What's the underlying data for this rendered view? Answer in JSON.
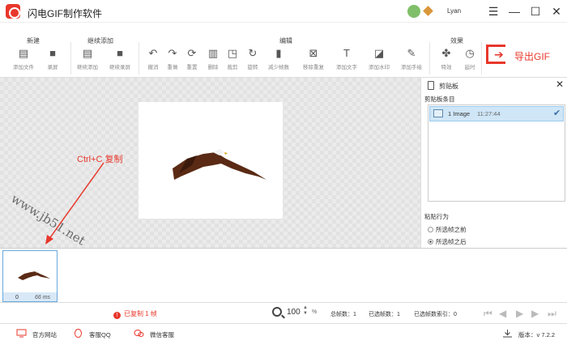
{
  "app": {
    "title": "闪电GIF制作软件",
    "username": "Lyan"
  },
  "window": {
    "minimize": "☰",
    "restore": "—",
    "maximize": "☐",
    "close": "✕"
  },
  "toolbar": {
    "groups": {
      "new": "新建",
      "continue": "继续添加",
      "edit": "编辑",
      "effects": "效果"
    },
    "buttons": {
      "add_file": "添加文件",
      "record": "录屏",
      "continue_add": "继续添加",
      "continue_record": "继续录屏",
      "undo": "撤消",
      "redo": "重做",
      "reset": "重置",
      "delete": "删除",
      "crop": "裁剪",
      "rotate": "旋转",
      "reduce_frames": "减少帧数",
      "remove_duplicates": "移除重复",
      "add_text": "添加文字",
      "add_watermark": "添加水印",
      "add_handwriting": "添加手绘",
      "effects": "特效",
      "delay": "延时"
    },
    "export": "导出GIF"
  },
  "canvas": {
    "watermark": "www.jb51.net",
    "annotation": "Ctrl+C 复制"
  },
  "panel": {
    "title": "剪贴板",
    "items_header": "剪贴板条目",
    "items": [
      {
        "name": "1 Image",
        "time": "11:27:44"
      }
    ],
    "paste_header": "粘贴行为",
    "paste_before": "所选帧之前",
    "paste_after": "所选帧之后",
    "paste_selected": "after"
  },
  "frames": [
    {
      "index": "0",
      "duration": "66 ms"
    }
  ],
  "status": {
    "copied": "已复制 1 帧",
    "zoom": "100",
    "zoom_unit": "%",
    "total_frames": "总帧数：1",
    "selected_frames": "已选帧数：1",
    "selected_index": "已选帧数索引：0"
  },
  "footer": {
    "website": "官方网站",
    "qq": "客服QQ",
    "wechat": "微信客服",
    "version": "版本：v 7.2.2"
  },
  "colors": {
    "accent": "#e8372b",
    "selection": "#cfe6f7"
  }
}
